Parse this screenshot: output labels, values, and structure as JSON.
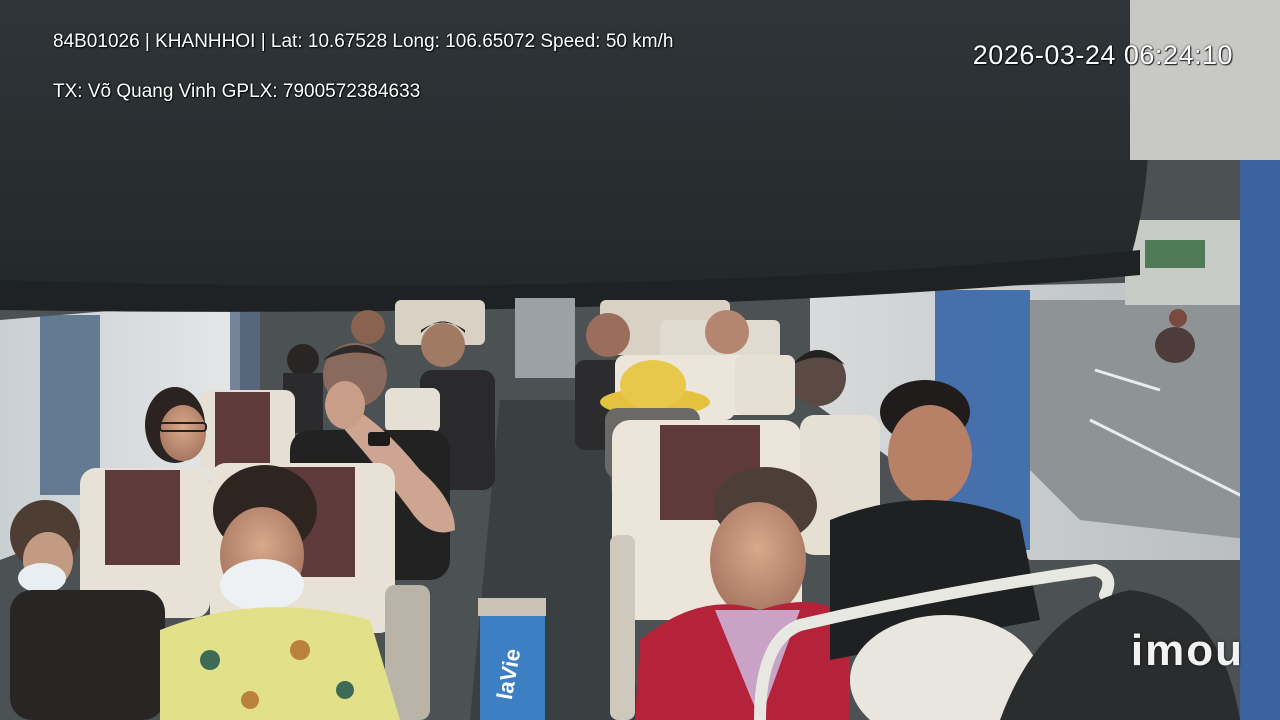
{
  "osd": {
    "line1": "84B01026 | KHANHHOI | Lat: 10.67528 Long: 106.65072 Speed: 50 km/h",
    "line2": "TX: Võ Quang Vinh GPLX: 7900572384633",
    "timestamp": "2026-03-24 06:24:10"
  },
  "watermark": {
    "brand": "imou"
  },
  "scene": {
    "description_visible": false,
    "bottle_label": "laVie"
  },
  "colors": {
    "ceiling": "#2c3133",
    "aisle_floor": "#4a4f52",
    "seat_cream": "#e8e2d6",
    "seat_maroon": "#5e3a3a",
    "curtain_blue": "#4f74a8",
    "window_glow": "#d9dde0"
  }
}
